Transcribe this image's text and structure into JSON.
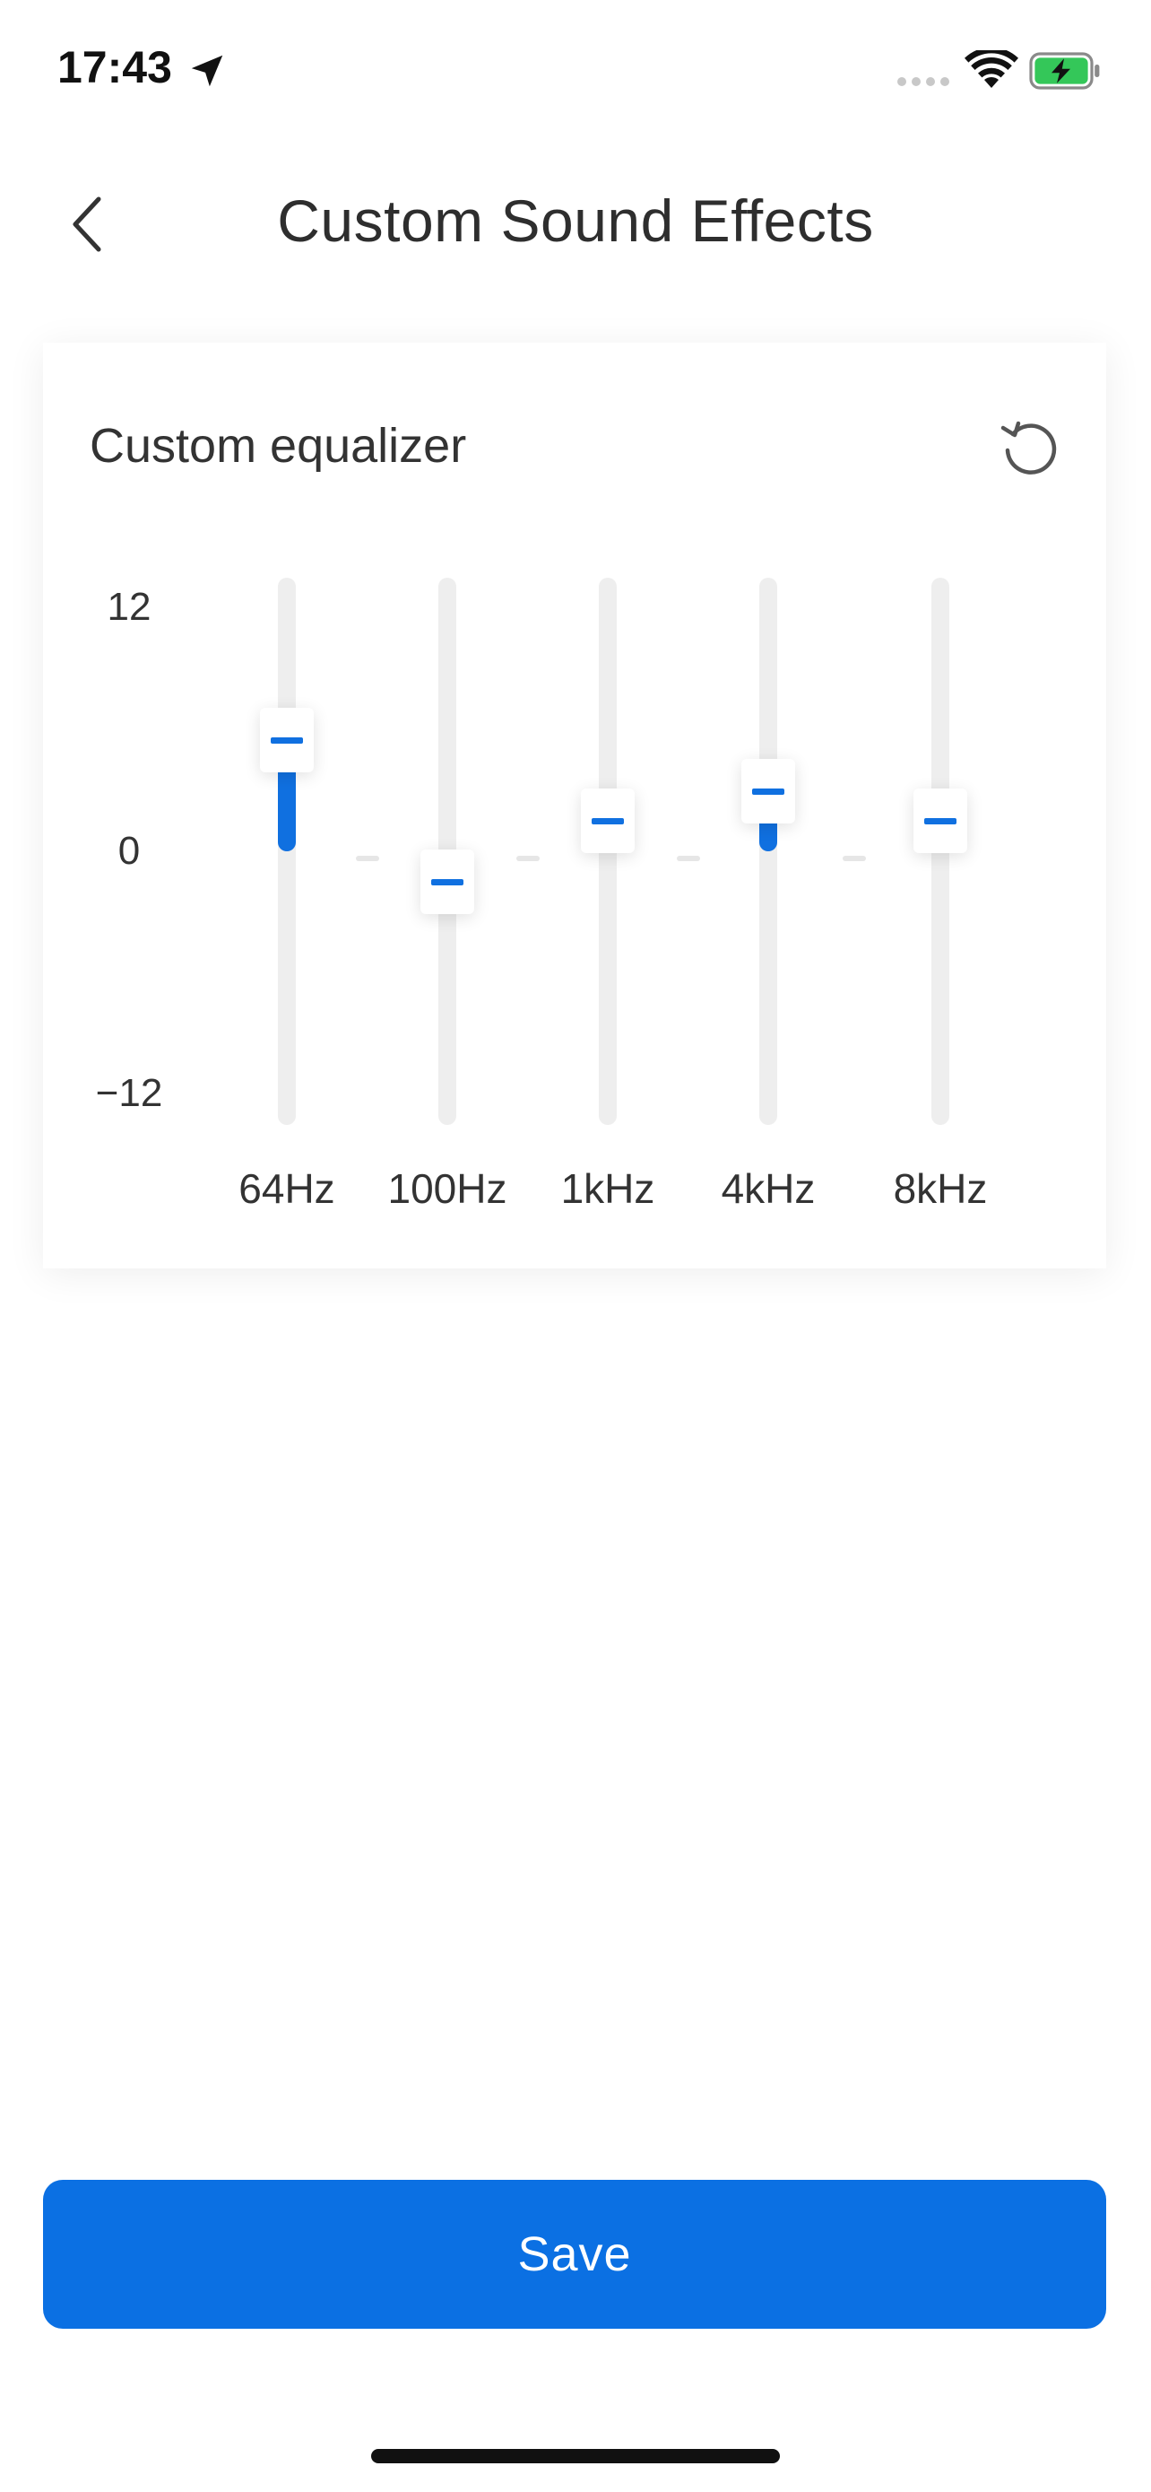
{
  "status_bar": {
    "time": "17:43"
  },
  "nav": {
    "title": "Custom Sound Effects"
  },
  "equalizer": {
    "title": "Custom equalizer",
    "axis": {
      "max_label": "12",
      "zero_label": "0",
      "min_label": "−12",
      "max": 12,
      "min": -12
    },
    "bands": [
      {
        "label": "64Hz",
        "gain": 5.5
      },
      {
        "label": "100Hz",
        "gain": -1.5
      },
      {
        "label": "1kHz",
        "gain": 1.5
      },
      {
        "label": "4kHz",
        "gain": 3
      },
      {
        "label": "8kHz",
        "gain": 1.5
      }
    ],
    "accent_color": "#0b70e3"
  },
  "actions": {
    "save_label": "Save"
  },
  "icons": {
    "back": "chevron-left-icon",
    "reset": "reset-icon",
    "location": "location-arrow-icon",
    "wifi": "wifi-icon",
    "battery": "battery-charging-icon",
    "signal": "signal-icon"
  }
}
